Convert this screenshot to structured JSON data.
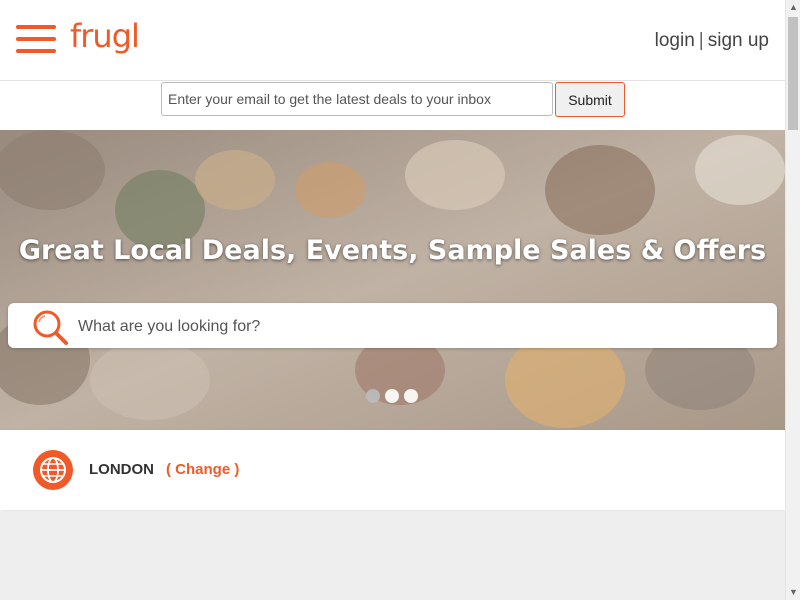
{
  "header": {
    "logo_text": "frugl",
    "login_label": "login",
    "separator": "|",
    "signup_label": "sign up"
  },
  "newsletter": {
    "email_placeholder": "Enter your email to get the latest deals to your inbox",
    "submit_label": "Submit"
  },
  "hero": {
    "title": "Great Local Deals, Events, Sample Sales & Offers",
    "search_placeholder": "What are you looking for?",
    "carousel_dots": 3,
    "active_dot": 0
  },
  "location": {
    "city": "LONDON",
    "change_label": "( Change )"
  },
  "icons": {
    "menu": "hamburger-menu-icon",
    "search": "search-icon",
    "location": "globe-icon"
  },
  "colors": {
    "brand": "#f05a28",
    "text": "#444444",
    "lower_section": "#eeeeee"
  }
}
